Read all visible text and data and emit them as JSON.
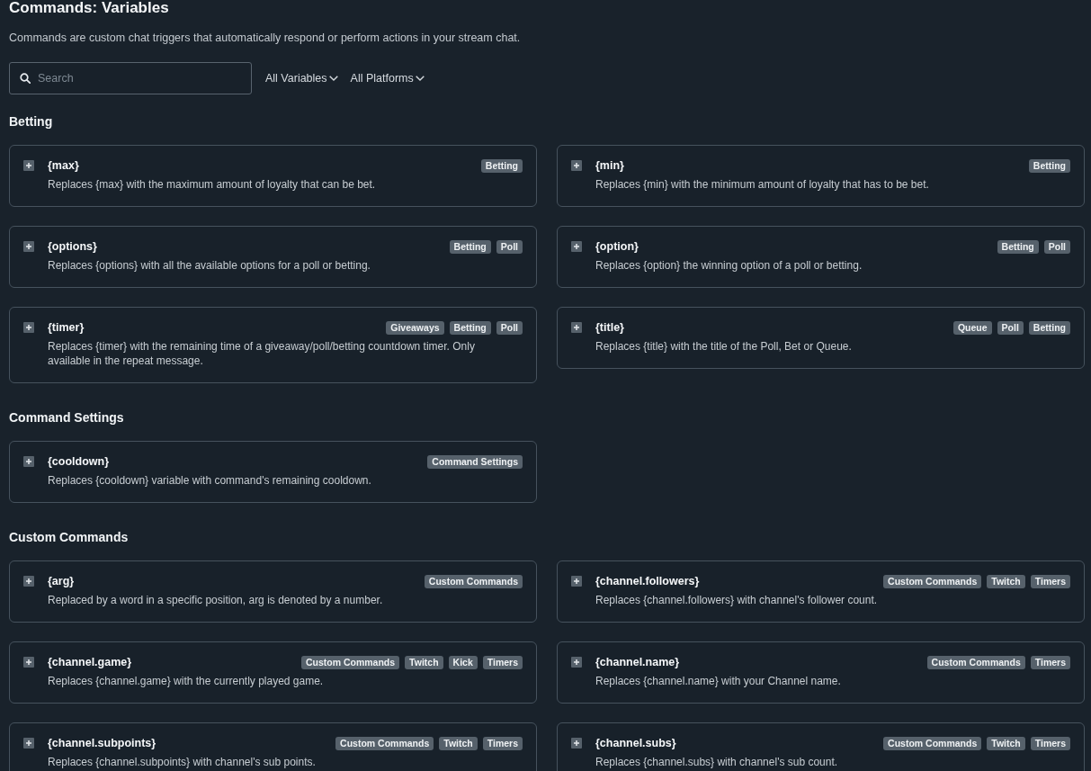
{
  "page": {
    "title": "Commands: Variables",
    "description": "Commands are custom chat triggers that automatically respond or perform actions in your stream chat."
  },
  "search": {
    "placeholder": "Search"
  },
  "filters": [
    {
      "label": "All Variables"
    },
    {
      "label": "All Platforms"
    }
  ],
  "sections": [
    {
      "title": "Betting",
      "variables": [
        {
          "name": "{max}",
          "expanded": false,
          "tags": [
            "Betting"
          ],
          "description": "Replaces {max} with the maximum amount of loyalty that can be bet."
        },
        {
          "name": "{min}",
          "expanded": false,
          "tags": [
            "Betting"
          ],
          "description": "Replaces {min} with the minimum amount of loyalty that has to be bet."
        },
        {
          "name": "{options}",
          "expanded": false,
          "tags": [
            "Betting",
            "Poll"
          ],
          "description": "Replaces {options} with all the available options for a poll or betting."
        },
        {
          "name": "{option}",
          "expanded": false,
          "tags": [
            "Betting",
            "Poll"
          ],
          "description": "Replaces {option} the winning option of a poll or betting."
        },
        {
          "name": "{timer}",
          "expanded": false,
          "tags": [
            "Giveaways",
            "Betting",
            "Poll"
          ],
          "description": "Replaces {timer} with the remaining time of a giveaway/poll/betting countdown timer. Only available in the repeat message."
        },
        {
          "name": "{title}",
          "expanded": false,
          "tags": [
            "Queue",
            "Poll",
            "Betting"
          ],
          "description": "Replaces {title} with the title of the Poll, Bet or Queue."
        }
      ]
    },
    {
      "title": "Command Settings",
      "variables": [
        {
          "name": "{cooldown}",
          "expanded": false,
          "tags": [
            "Command Settings"
          ],
          "description": "Replaces {cooldown} variable with command's remaining cooldown."
        }
      ]
    },
    {
      "title": "Custom Commands",
      "variables": [
        {
          "name": "{arg}",
          "expanded": false,
          "tags": [
            "Custom Commands"
          ],
          "description": "Replaced by a word in a specific position, arg is denoted by a number."
        },
        {
          "name": "{channel.followers}",
          "expanded": false,
          "tags": [
            "Custom Commands",
            "Twitch",
            "Timers"
          ],
          "description": "Replaces {channel.followers} with channel's follower count."
        },
        {
          "name": "{channel.game}",
          "expanded": false,
          "tags": [
            "Custom Commands",
            "Twitch",
            "Kick",
            "Timers"
          ],
          "description": "Replaces {channel.game} with the currently played game."
        },
        {
          "name": "{channel.name}",
          "expanded": false,
          "tags": [
            "Custom Commands",
            "Timers"
          ],
          "description": "Replaces {channel.name} with your Channel name."
        },
        {
          "name": "{channel.subpoints}",
          "expanded": false,
          "tags": [
            "Custom Commands",
            "Twitch",
            "Timers"
          ],
          "description": "Replaces {channel.subpoints} with channel's sub points."
        },
        {
          "name": "{channel.subs}",
          "expanded": false,
          "tags": [
            "Custom Commands",
            "Twitch",
            "Timers"
          ],
          "description": "Replaces {channel.subs} with channel's sub count."
        }
      ]
    }
  ]
}
